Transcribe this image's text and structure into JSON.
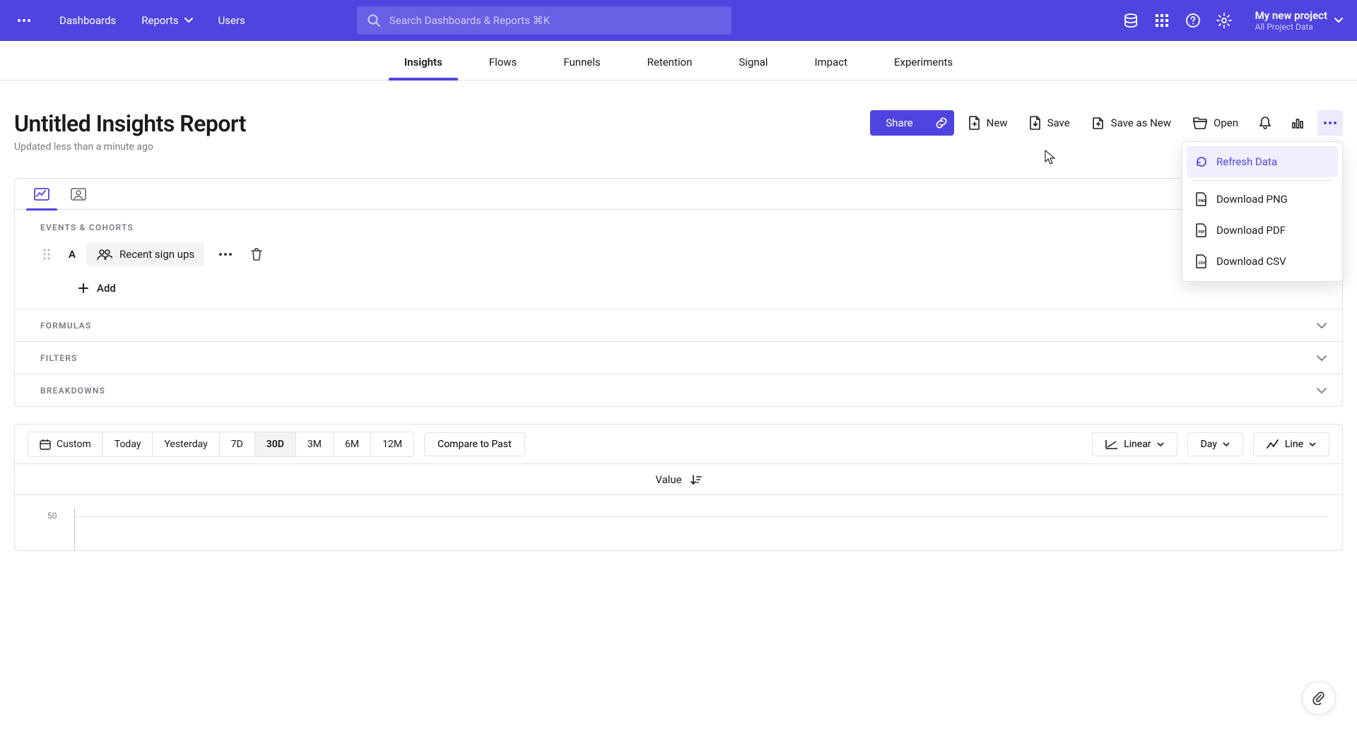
{
  "nav": {
    "dashboards": "Dashboards",
    "reports": "Reports",
    "users": "Users",
    "search_placeholder": "Search Dashboards & Reports ⌘K"
  },
  "project": {
    "name": "My new project",
    "sub": "All Project Data"
  },
  "tabs": {
    "insights": "Insights",
    "flows": "Flows",
    "funnels": "Funnels",
    "retention": "Retention",
    "signal": "Signal",
    "impact": "Impact",
    "experiments": "Experiments"
  },
  "page": {
    "title": "Untitled Insights Report",
    "subtitle": "Updated less than a minute ago"
  },
  "actions": {
    "share": "Share",
    "new": "New",
    "save": "Save",
    "save_as_new": "Save as New",
    "open": "Open"
  },
  "menu": {
    "refresh": "Refresh Data",
    "png": "Download PNG",
    "pdf": "Download PDF",
    "csv": "Download CSV"
  },
  "config": {
    "events_header": "EVENTS & COHORTS",
    "event_letter": "A",
    "event_name": "Recent sign ups",
    "add": "Add",
    "formulas": "FORMULAS",
    "filters": "FILTERS",
    "breakdowns": "BREAKDOWNS"
  },
  "range": {
    "custom": "Custom",
    "today": "Today",
    "yesterday": "Yesterday",
    "d7": "7D",
    "d30": "30D",
    "m3": "3M",
    "m6": "6M",
    "m12": "12M",
    "compare": "Compare to Past",
    "linear": "Linear",
    "day": "Day",
    "line": "Line"
  },
  "chart_header": {
    "value": "Value"
  },
  "chart_data": {
    "type": "line",
    "y_ticks": [
      "50"
    ],
    "ylim": [
      0,
      50
    ],
    "series": []
  }
}
